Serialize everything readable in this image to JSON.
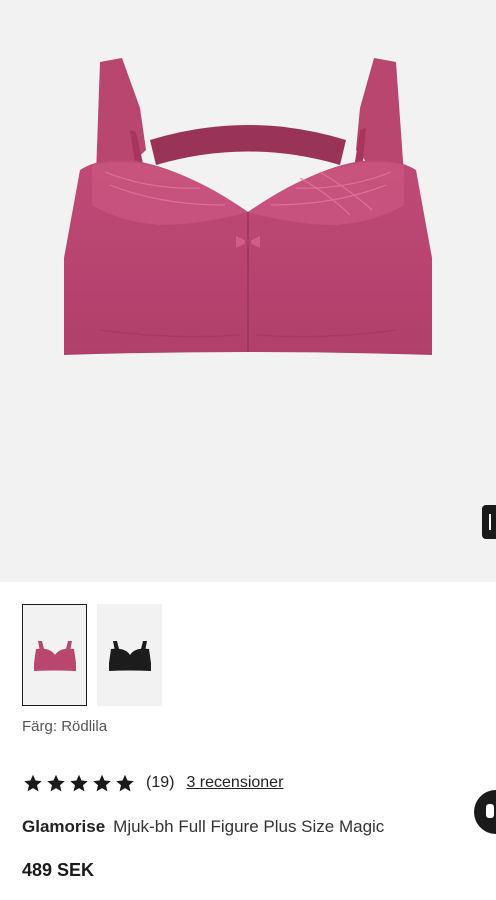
{
  "product_image": {
    "alt": "",
    "icon": "bra-product-image"
  },
  "gallery": {
    "next_icon": "chevron-right-icon",
    "thumbnails": [
      {
        "color": "#b8466f",
        "selected": true
      },
      {
        "color": "#1c1c1c",
        "selected": false
      }
    ]
  },
  "color": {
    "label": "Färg:",
    "value": "Rödlila"
  },
  "rating": {
    "stars": 5,
    "count": "(19)",
    "reviews_link": "3 recensioner"
  },
  "product": {
    "brand": "Glamorise",
    "name": "Mjuk-bh Full Figure Plus Size Magic"
  },
  "price": "489 SEK",
  "chat": {
    "icon": "chat-icon"
  },
  "colors": {
    "bra_pink": "#b8466f",
    "bra_dark": "#9a3358",
    "background": "#f3f2f3"
  }
}
